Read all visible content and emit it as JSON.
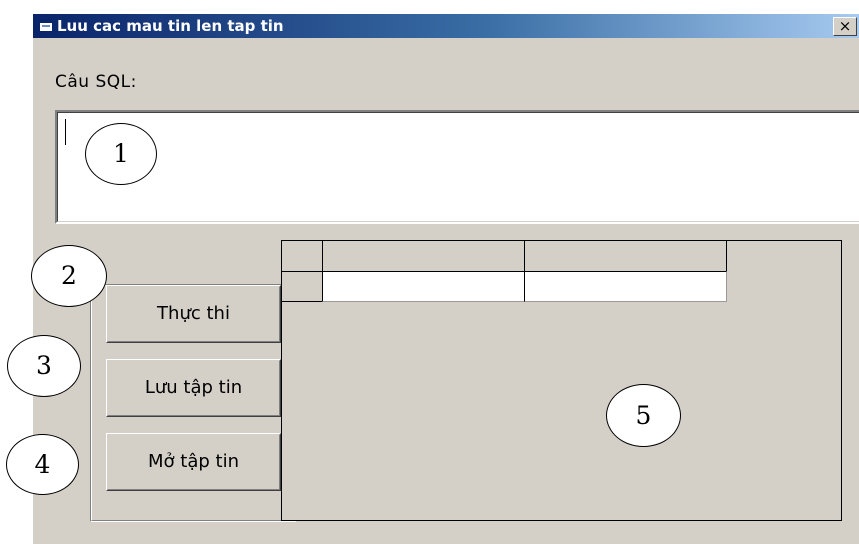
{
  "window": {
    "title": "Luu cac mau tin len tap tin",
    "close_glyph": "×",
    "icon": "app-window-icon"
  },
  "form": {
    "sql_label": "Câu SQL:",
    "sql_value": ""
  },
  "buttons": {
    "execute": "Thực thi",
    "save": "Lưu tập tin",
    "open": "Mở tập tin"
  },
  "grid": {
    "columns": [
      "",
      ""
    ],
    "rows": [
      [
        "",
        ""
      ]
    ]
  },
  "callouts": [
    "1",
    "2",
    "3",
    "4",
    "5"
  ],
  "colors": {
    "face": "#d4d0c8",
    "title_start": "#0a246a",
    "title_end": "#a6caf0"
  }
}
